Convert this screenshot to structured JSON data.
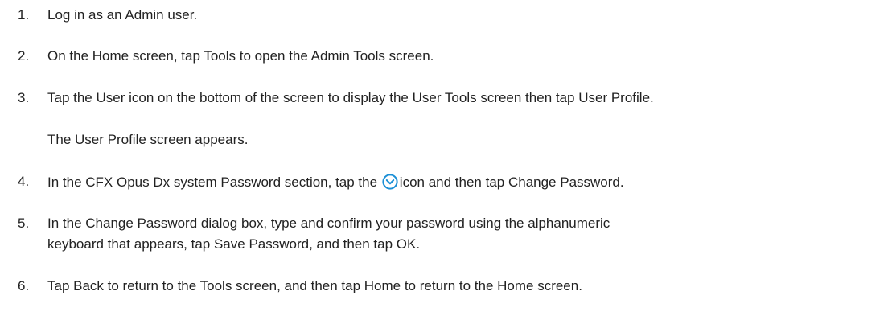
{
  "steps": [
    {
      "number": "1.",
      "text": "Log in as an Admin user."
    },
    {
      "number": "2.",
      "text": "On the Home screen, tap Tools to open the Admin Tools screen."
    },
    {
      "number": "3.",
      "text": "Tap the User icon on the bottom of the screen to display the User Tools screen then tap User Profile.",
      "result": "The User Profile screen appears."
    },
    {
      "number": "4.",
      "text_before": "In the CFX Opus Dx system Password section, tap the",
      "icon": "chevron-down-circle-icon",
      "text_after": "icon and then tap Change Password."
    },
    {
      "number": "5.",
      "line1": "In the Change Password dialog box, type and confirm your password using the alphanumeric",
      "line2": "keyboard that appears, tap Save Password, and then tap OK."
    },
    {
      "number": "6.",
      "text": "Tap Back to return to the Tools screen, and then tap Home to return to the Home screen."
    }
  ],
  "colors": {
    "text": "#222222",
    "icon_accent": "#1a8fd6"
  }
}
